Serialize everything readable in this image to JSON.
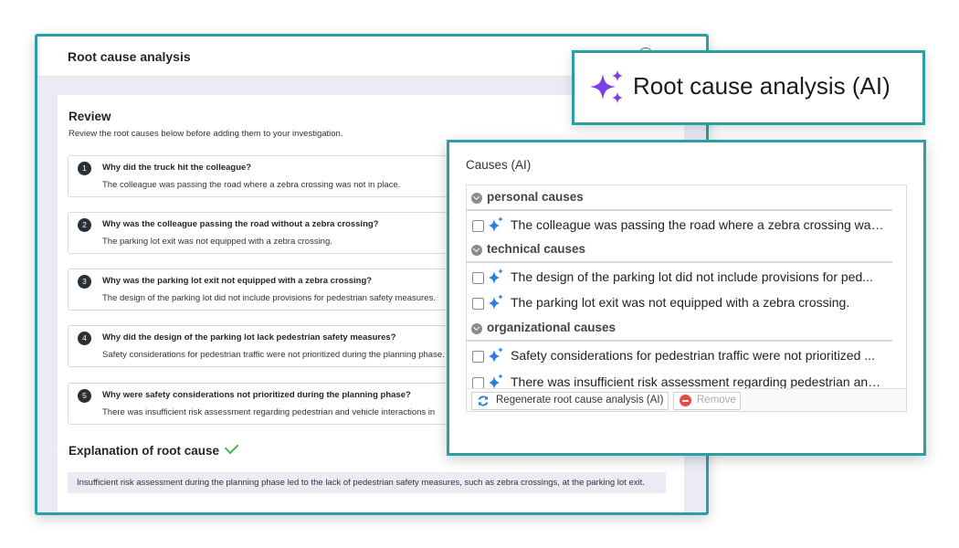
{
  "main": {
    "title": "Root cause analysis",
    "review_title": "Review",
    "review_subtitle": "Review the root causes below before adding them to your investigation.",
    "whys": [
      {
        "num": "1",
        "question": "Why did the truck hit the colleague?",
        "answer": "The colleague was passing the road where a zebra crossing was not in place."
      },
      {
        "num": "2",
        "question": "Why was the colleague passing the road without a zebra crossing?",
        "answer": "The parking lot exit was not equipped with a zebra crossing."
      },
      {
        "num": "3",
        "question": "Why was the parking lot exit not equipped with a zebra crossing?",
        "answer": "The design of the parking lot did not include provisions for pedestrian safety measures."
      },
      {
        "num": "4",
        "question": "Why did the design of the parking lot lack pedestrian safety measures?",
        "answer": "Safety considerations for pedestrian traffic were not prioritized during the planning phase."
      },
      {
        "num": "5",
        "question": "Why were safety considerations not prioritized during the planning phase?",
        "answer": "There was insufficient risk assessment regarding pedestrian and vehicle interactions in"
      }
    ],
    "explanation_title": "Explanation of root cause",
    "explanation_text": "Insufficient risk assessment during the planning phase led to the lack of pedestrian safety measures, such as zebra crossings, at the parking lot exit."
  },
  "callout": {
    "title": "Root cause analysis (AI)"
  },
  "ai_panel": {
    "title": "Causes (AI)",
    "groups": [
      {
        "label": "personal causes",
        "items": [
          "The colleague was passing the road where a zebra crossing was ..."
        ]
      },
      {
        "label": "technical causes",
        "items": [
          "The design of the parking lot did not include provisions for ped...",
          "The parking lot exit was not equipped with a zebra crossing."
        ]
      },
      {
        "label": "organizational causes",
        "items": [
          "Safety considerations for pedestrian traffic were not prioritized ...",
          "There was insufficient risk assessment regarding pedestrian and ..."
        ]
      }
    ],
    "regenerate_label": "Regenerate root cause analysis (AI)",
    "remove_label": "Remove"
  },
  "colors": {
    "accent": "#2aa0a4",
    "sparkle": "#7b3fe4",
    "ai_sparkle": "#2a7de1"
  }
}
